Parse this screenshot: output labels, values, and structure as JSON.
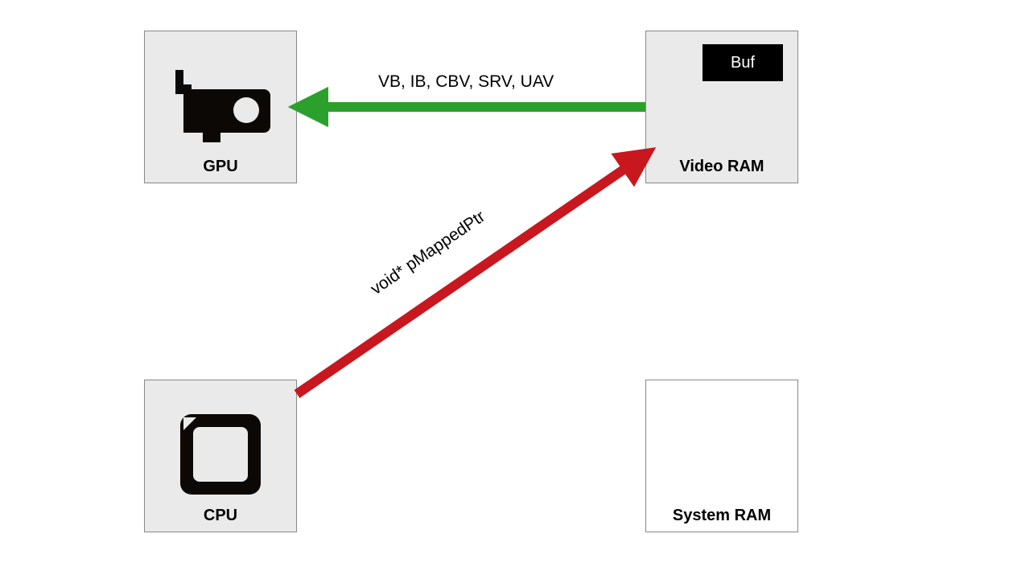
{
  "nodes": {
    "gpu": {
      "label": "GPU"
    },
    "cpu": {
      "label": "CPU"
    },
    "vram": {
      "label": "Video RAM",
      "chip": "Buf"
    },
    "sysram": {
      "label": "System RAM"
    }
  },
  "arrows": {
    "green_label": "VB, IB, CBV, SRV, UAV",
    "red_label": "void* pMappedPtr"
  },
  "colors": {
    "green": "#2ca02c",
    "red": "#c8171e"
  }
}
